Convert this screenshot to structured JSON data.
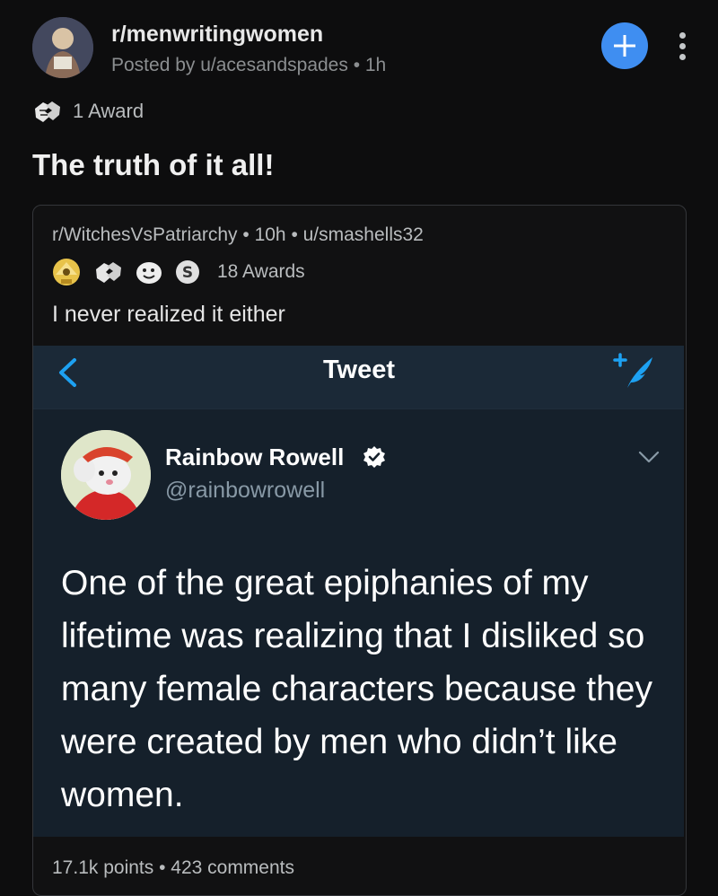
{
  "header": {
    "subreddit": "r/menwritingwomen",
    "posted_by": "Posted by u/acesandspades • 1h",
    "awards": "1 Award"
  },
  "post": {
    "title": "The truth of it all!"
  },
  "crosspost": {
    "meta": "r/WitchesVsPatriarchy • 10h • u/smashells32",
    "awards_count": "18 Awards",
    "title": "I never realized it either",
    "footer": "17.1k points • 423 comments"
  },
  "tweet": {
    "bar_title": "Tweet",
    "name": "Rainbow Rowell",
    "handle": "@rainbowrowell",
    "text": "One of the great epiphanies of my lifetime was realizing that I disliked so many female characters because they were created by men who didn’t like women."
  },
  "colors": {
    "accent": "#3f8ef1",
    "tweet_bg": "#15202b",
    "twitter_blue": "#1da1f2"
  },
  "icons": [
    "subreddit-avatar",
    "join-plus-icon",
    "more-vertical-icon",
    "award-icon",
    "back-chevron-icon",
    "compose-tweet-icon",
    "verified-badge-icon",
    "chevron-down-icon"
  ]
}
